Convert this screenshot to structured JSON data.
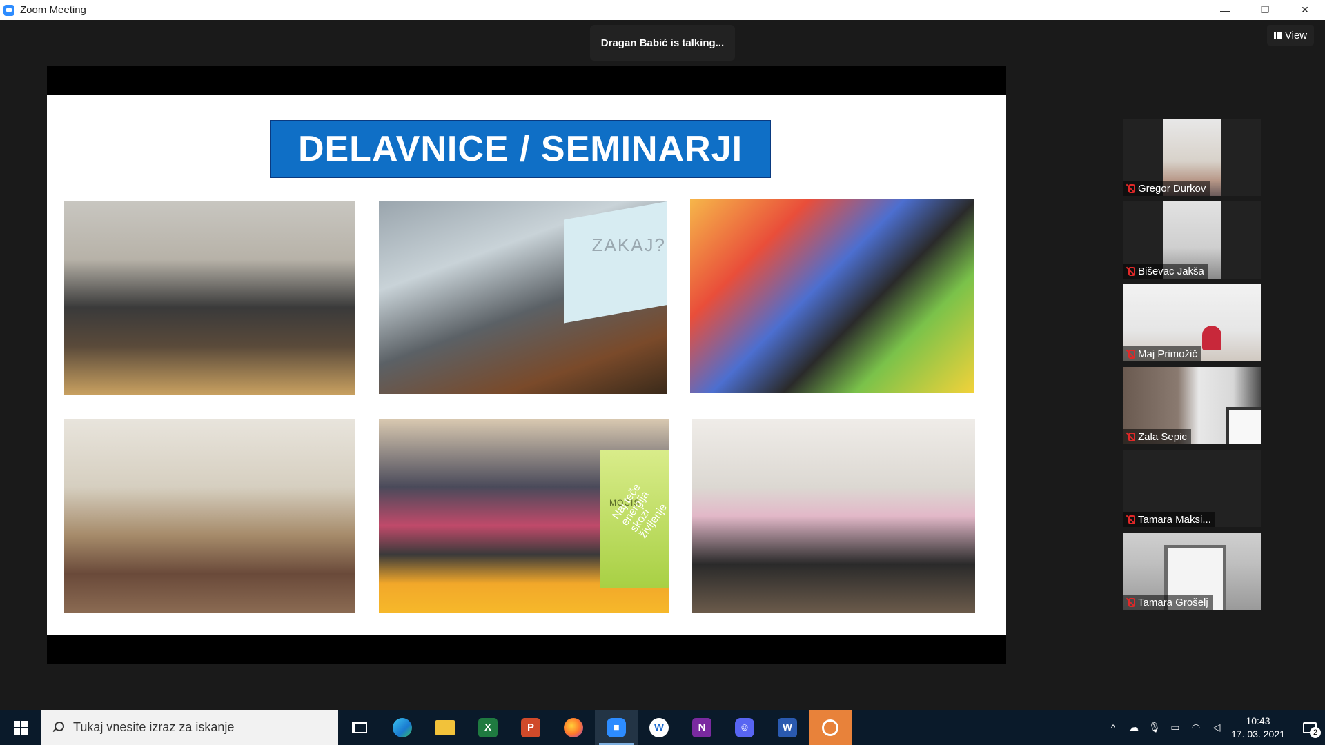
{
  "window": {
    "title": "Zoom Meeting",
    "minimize": "—",
    "restore": "❐",
    "close": "✕"
  },
  "meeting": {
    "talking_indicator": "Dragan Babić is talking...",
    "view_label": "View"
  },
  "slide": {
    "title": "DELAVNICE / SEMINARJI",
    "photo2_screen_text": "ZAKAJ?",
    "photo5_banner_brand": "MOCIS",
    "photo5_banner_text": "Naj teče energija skozi življenje"
  },
  "participants": [
    {
      "name": "Gregor Durkov",
      "muted": true
    },
    {
      "name": "Biševac Jakša",
      "muted": true
    },
    {
      "name": "Maj Primožič",
      "muted": true
    },
    {
      "name": "Zala Sepic",
      "muted": true
    },
    {
      "name": "Tamara Maksi...",
      "muted": true
    },
    {
      "name": "Tamara Grošelj",
      "muted": true
    }
  ],
  "taskbar": {
    "search_placeholder": "Tukaj vnesite izraz za iskanje",
    "apps": [
      {
        "icon": "task-view-icon"
      },
      {
        "icon": "edge-icon"
      },
      {
        "icon": "file-explorer-icon"
      },
      {
        "icon": "excel-icon"
      },
      {
        "icon": "powerpoint-icon"
      },
      {
        "icon": "firefox-icon"
      },
      {
        "icon": "zoom-icon",
        "active": true
      },
      {
        "icon": "app-w-icon"
      },
      {
        "icon": "onenote-icon"
      },
      {
        "icon": "discord-icon"
      },
      {
        "icon": "word-icon"
      },
      {
        "icon": "app-orange-icon"
      }
    ],
    "time": "10:43",
    "date": "17. 03. 2021",
    "notification_count": "2"
  },
  "colors": {
    "accent": "#2d8cff",
    "slide_title_bg": "#0f6fc6",
    "muted_red": "#e02828",
    "taskbar_bg": "#0a1a2a"
  }
}
